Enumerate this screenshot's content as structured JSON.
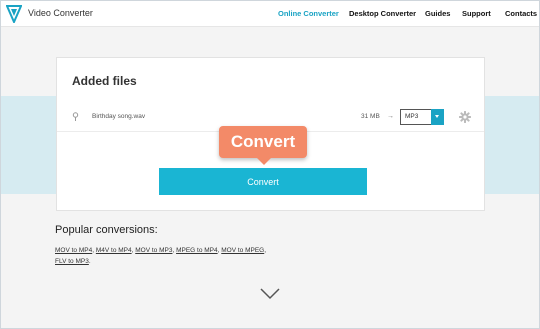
{
  "header": {
    "brand": "Video Converter",
    "nav": [
      {
        "label": "Online Converter",
        "active": true
      },
      {
        "label": "Desktop Converter",
        "active": false
      },
      {
        "label": "Guides",
        "active": false
      },
      {
        "label": "Support",
        "active": false
      },
      {
        "label": "Contacts",
        "active": false
      }
    ]
  },
  "card": {
    "title": "Added files",
    "file": {
      "name": "Birthday song.wav",
      "size": "31 MB",
      "format": "MP3"
    },
    "convert_label": "Convert"
  },
  "callout": {
    "label": "Convert"
  },
  "popular": {
    "heading": "Popular conversions:",
    "links": [
      "MOV to MP4",
      "M4V to MP4",
      "MOV to MP3",
      "MPEG to MP4",
      "MOV to MPEG",
      "FLV to MP3"
    ]
  },
  "colors": {
    "accent": "#1ab5d3",
    "nav_active": "#1aa3c4",
    "callout": "#f38a68",
    "band": "#d6ebf1"
  },
  "icons": [
    "logo-icon",
    "pin-icon",
    "arrow-right-icon",
    "chevron-down-icon",
    "gear-icon",
    "scroll-down-chevron-icon"
  ]
}
